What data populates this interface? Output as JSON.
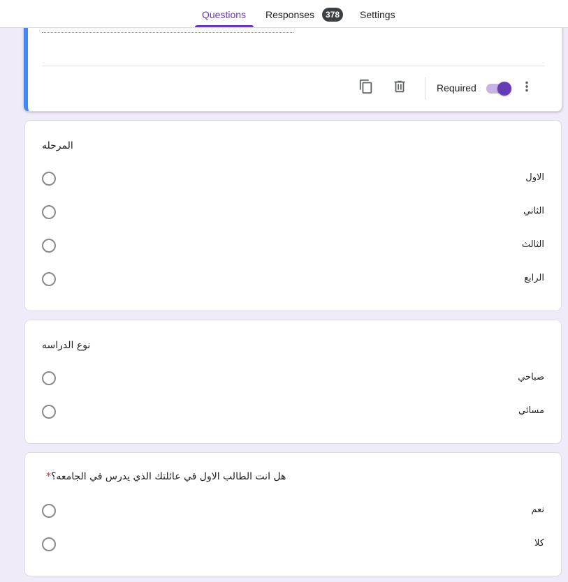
{
  "tabs": [
    {
      "label": "Questions",
      "active": true
    },
    {
      "label": "Responses",
      "badge": "378"
    },
    {
      "label": "Settings"
    }
  ],
  "active_card": {
    "required_label": "Required",
    "required_on": true,
    "icons": [
      "copy-icon",
      "delete-icon",
      "more-vert-icon"
    ]
  },
  "questions": [
    {
      "title": "المرحله",
      "required": false,
      "options": [
        "الاول",
        "الثاني",
        "الثالث",
        "الرابع"
      ]
    },
    {
      "title": "نوع الدراسه",
      "required": false,
      "options": [
        "صباحي",
        "مسائي"
      ]
    },
    {
      "title": "هل انت الطالب الاول في عائلتك الذي يدرس في الجامعه؟",
      "required": true,
      "required_mark": "*",
      "options": [
        "نعم",
        "كلا"
      ]
    }
  ],
  "colors": {
    "accent": "#673ab7",
    "background": "#f0ebf8",
    "active_border": "#4285f4",
    "required_star": "#d93025"
  }
}
